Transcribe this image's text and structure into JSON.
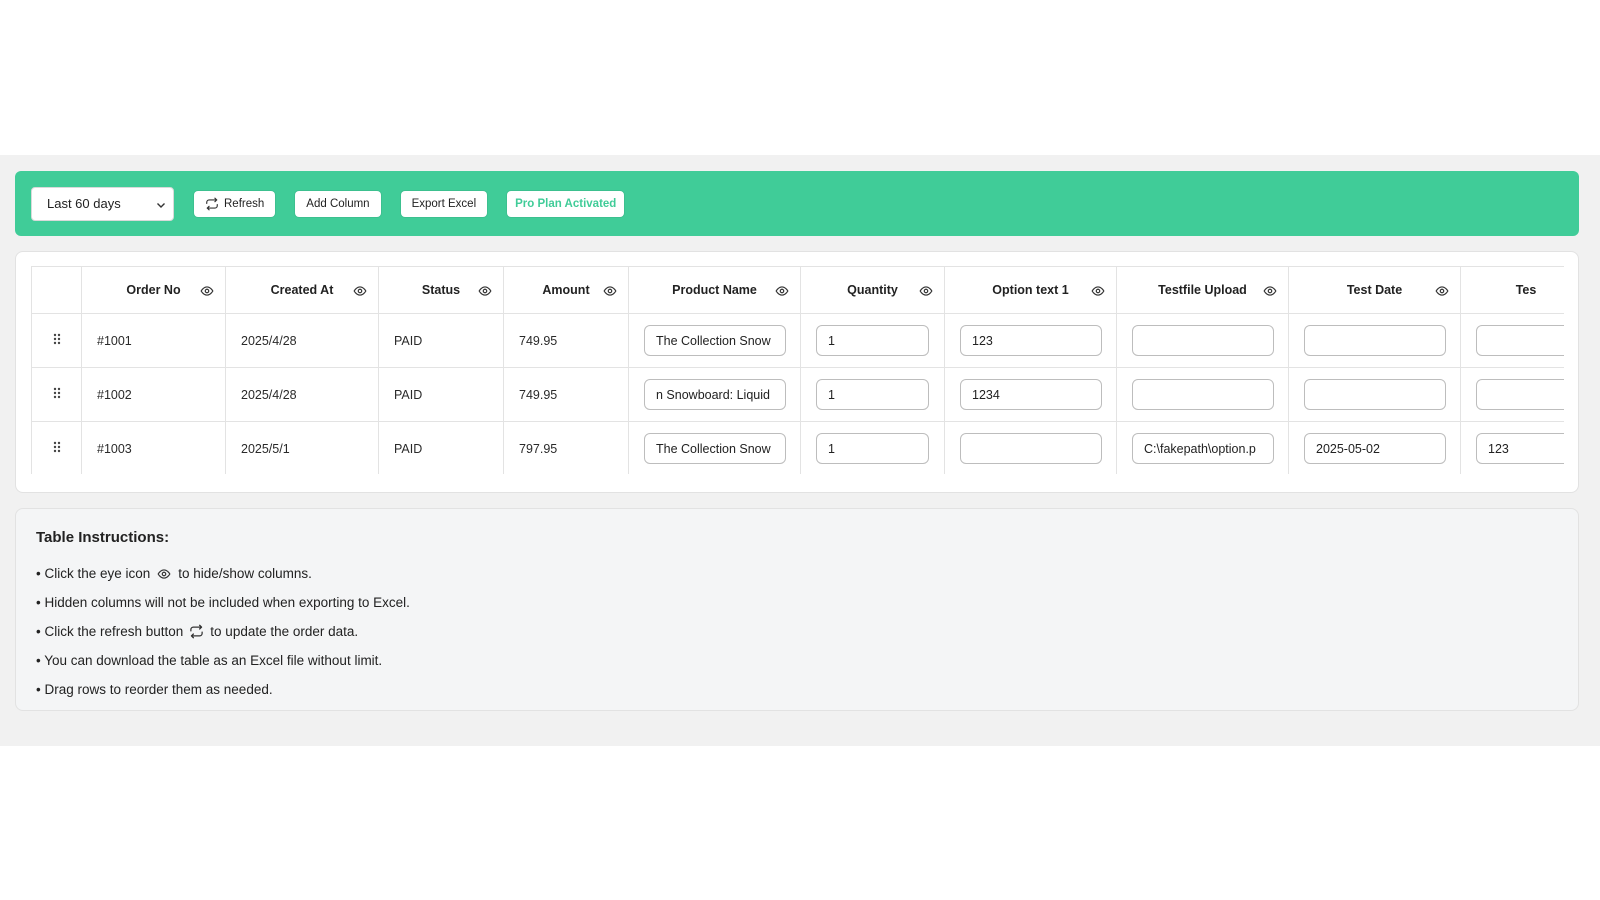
{
  "toolbar": {
    "range_select": "Last 60 days",
    "refresh_label": "Refresh",
    "add_column_label": "Add Column",
    "export_label": "Export Excel",
    "plan_label": "Pro Plan Activated"
  },
  "table": {
    "columns": [
      "Order No",
      "Created At",
      "Status",
      "Amount",
      "Product Name",
      "Quantity",
      "Option text 1",
      "Testfile Upload",
      "Test Date",
      "Tes"
    ],
    "rows": [
      {
        "order_no": "#1001",
        "created_at": "2025/4/28",
        "status": "PAID",
        "amount": "749.95",
        "product_name": "The Collection Snow",
        "quantity": "1",
        "option_text_1": "123",
        "testfile_upload": "",
        "test_date": "",
        "extra": ""
      },
      {
        "order_no": "#1002",
        "created_at": "2025/4/28",
        "status": "PAID",
        "amount": "749.95",
        "product_name": "n Snowboard: Liquid",
        "quantity": "1",
        "option_text_1": "1234",
        "testfile_upload": "",
        "test_date": "",
        "extra": ""
      },
      {
        "order_no": "#1003",
        "created_at": "2025/5/1",
        "status": "PAID",
        "amount": "797.95",
        "product_name": "The Collection Snow",
        "quantity": "1",
        "option_text_1": "",
        "testfile_upload": "C:\\fakepath\\option.p",
        "test_date": "2025-05-02",
        "extra": "123"
      }
    ]
  },
  "instructions": {
    "title": "Table Instructions:",
    "item1_pre": "• Click the eye icon",
    "item1_post": "to hide/show columns.",
    "item2": "• Hidden columns will not be included when exporting to Excel.",
    "item3_pre": "• Click the refresh button",
    "item3_post": "to update the order data.",
    "item4": "• You can download the table as an Excel file without limit.",
    "item5": "• Drag rows to reorder them as needed."
  },
  "colors": {
    "accent": "#40cc98",
    "background": "#f1f1f1",
    "border": "#e3e3e3"
  },
  "icons": [
    "chevron-down-icon",
    "refresh-icon",
    "eye-icon",
    "drag-handle-icon"
  ]
}
